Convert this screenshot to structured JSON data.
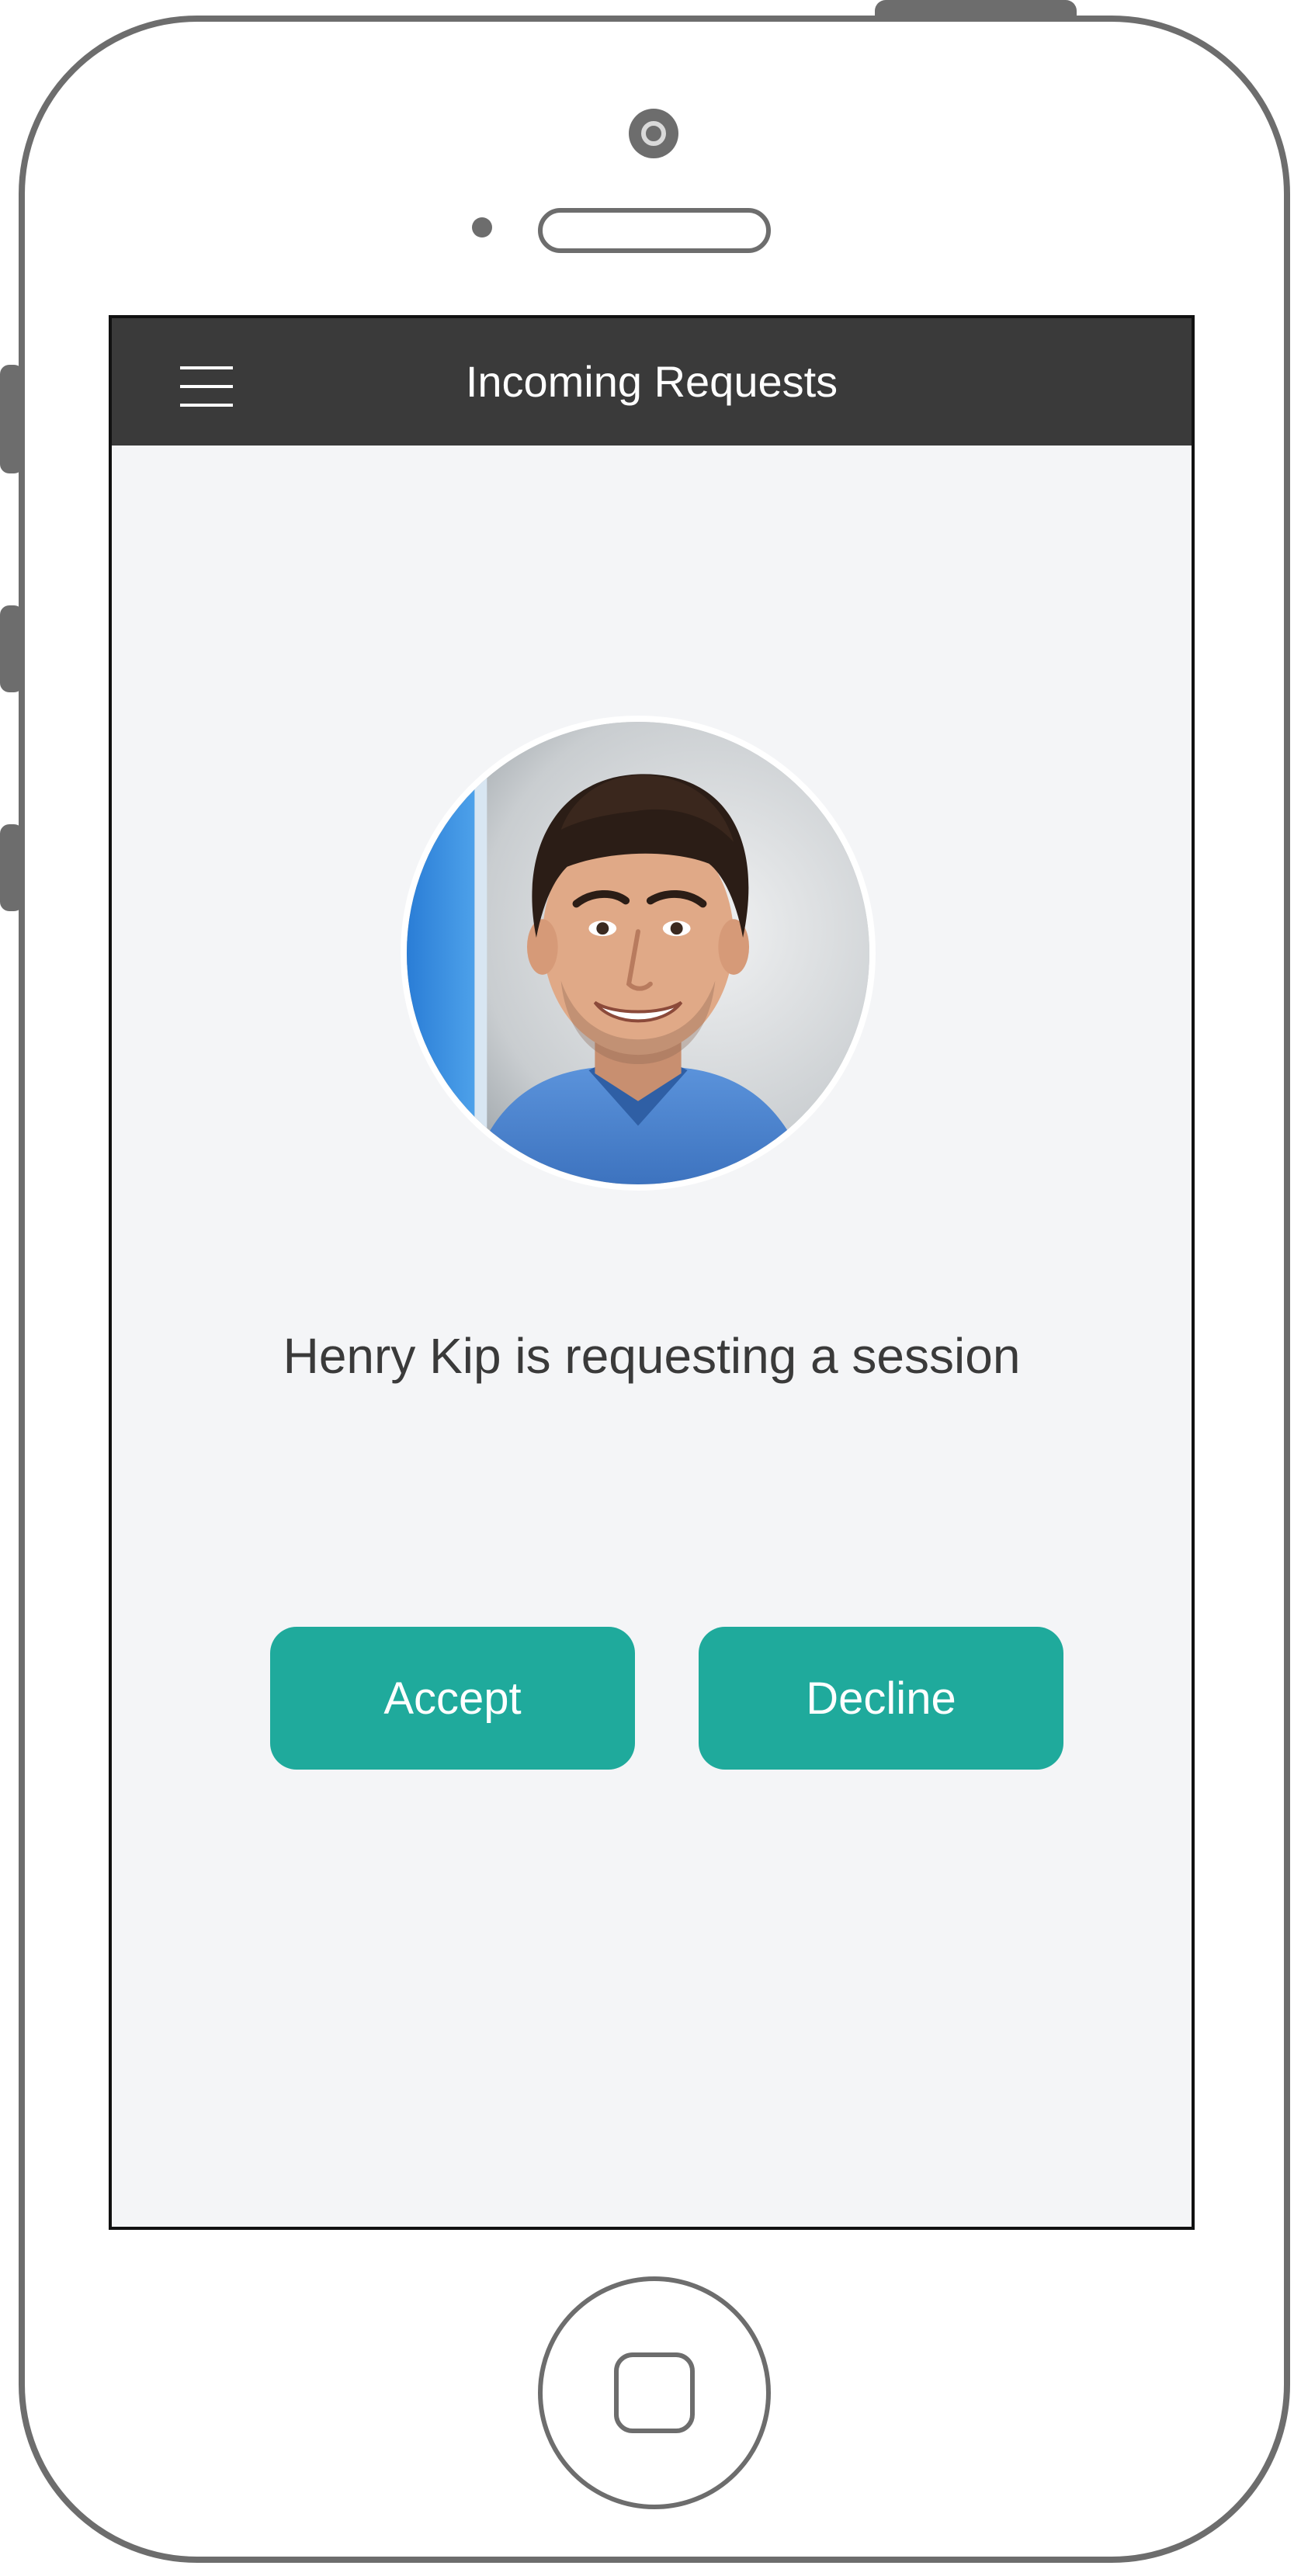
{
  "app_bar": {
    "title": "Incoming Requests",
    "menu_icon": "hamburger-menu-icon"
  },
  "request": {
    "requester_name": "Henry Kip",
    "message": "Henry Kip is requesting a session",
    "avatar_icon": "profile-photo"
  },
  "actions": {
    "accept_label": "Accept",
    "decline_label": "Decline"
  },
  "colors": {
    "app_bar": "#3a3a3a",
    "screen_background": "#f4f5f7",
    "button": "#1faa9c",
    "button_text": "#ffffff",
    "device_frame": "#6d6d6d"
  }
}
